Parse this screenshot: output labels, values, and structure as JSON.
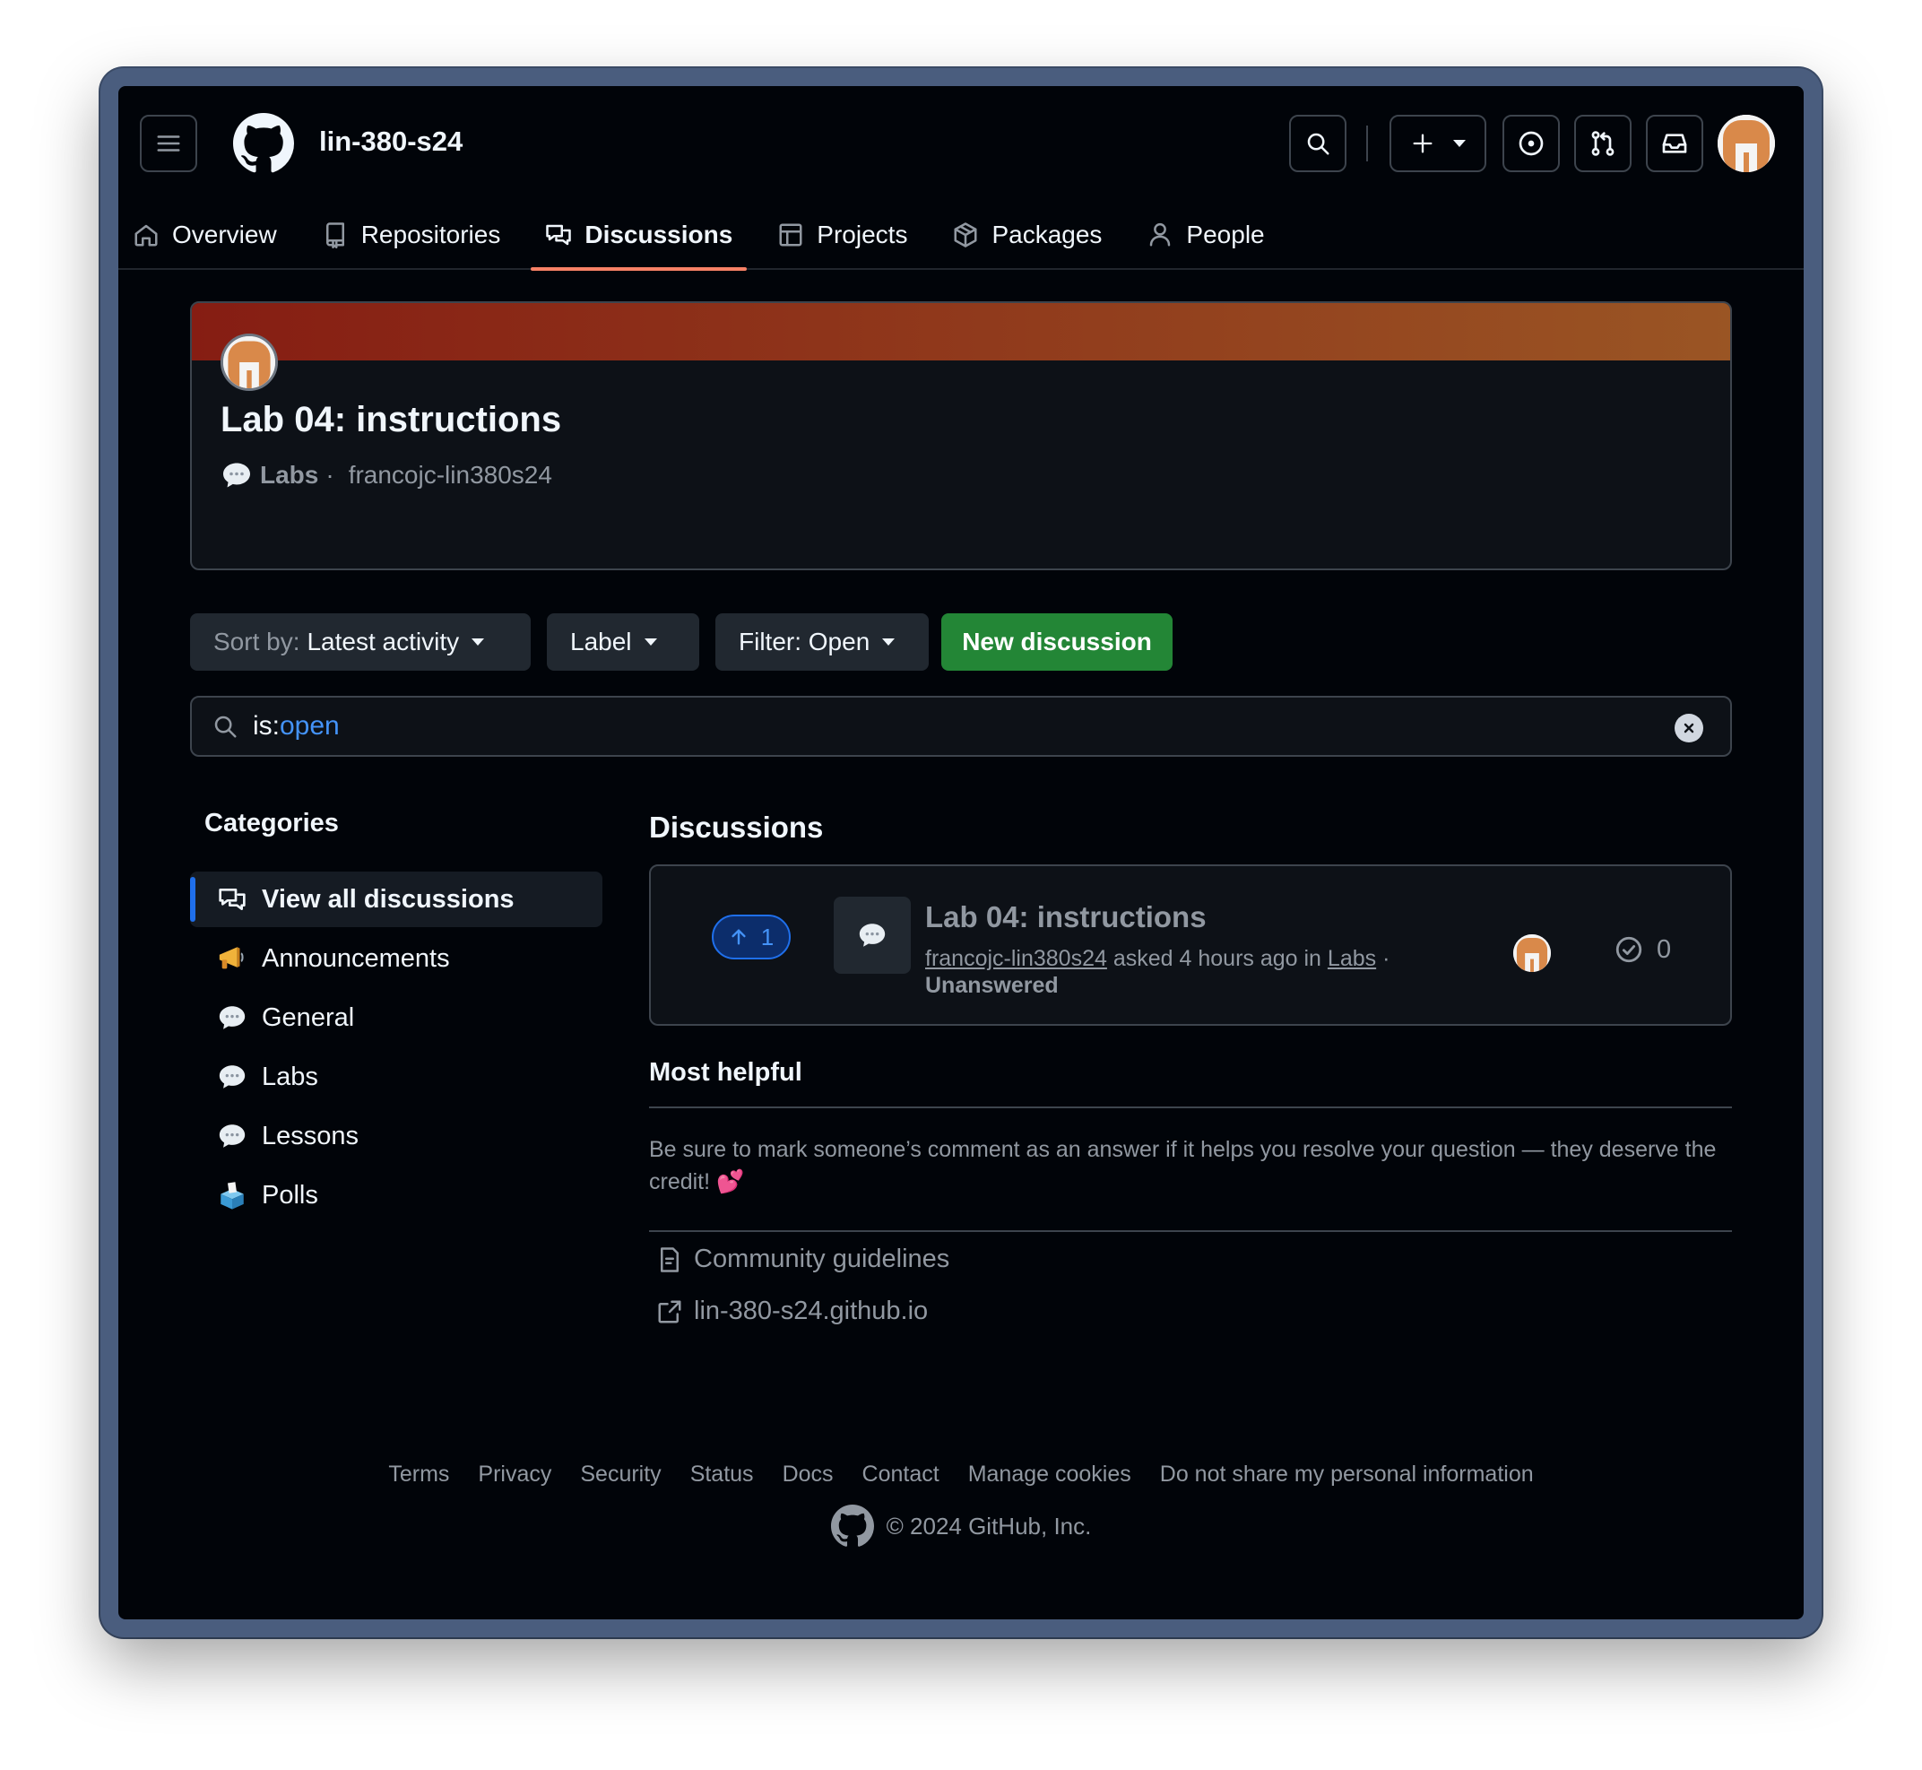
{
  "header": {
    "org_name": "lin-380-s24"
  },
  "nav": {
    "items": [
      {
        "label": "Overview",
        "icon": "home-icon"
      },
      {
        "label": "Repositories",
        "icon": "repo-icon"
      },
      {
        "label": "Discussions",
        "icon": "comment-discussion-icon",
        "active": true
      },
      {
        "label": "Projects",
        "icon": "table-icon"
      },
      {
        "label": "Packages",
        "icon": "package-icon"
      },
      {
        "label": "People",
        "icon": "person-icon"
      }
    ]
  },
  "banner": {
    "title": "Lab 04: instructions",
    "category": "Labs",
    "separator": "·",
    "author": "francojc-lin380s24"
  },
  "controls": {
    "sort_prefix": "Sort by:",
    "sort_value": "Latest activity",
    "label": "Label",
    "filter": "Filter: Open",
    "new_discussion": "New discussion"
  },
  "search": {
    "prefix": "is:",
    "value": "open"
  },
  "categories": {
    "heading": "Categories",
    "items": [
      {
        "label": "View all discussions",
        "icon": "comment-discussion-icon",
        "active": true
      },
      {
        "label": "Announcements",
        "icon": "megaphone-emoji"
      },
      {
        "label": "General",
        "icon": "speech-balloon-emoji"
      },
      {
        "label": "Labs",
        "icon": "speech-balloon-emoji"
      },
      {
        "label": "Lessons",
        "icon": "speech-balloon-emoji"
      },
      {
        "label": "Polls",
        "icon": "ballot-box-emoji"
      }
    ]
  },
  "discussions": {
    "heading": "Discussions",
    "items": [
      {
        "votes": "1",
        "title": "Lab 04: instructions",
        "author": "francojc-lin380s24",
        "asked": "asked 4 hours ago in",
        "category": "Labs",
        "separator": "·",
        "status": "Unanswered",
        "answers": "0"
      }
    ]
  },
  "most_helpful": {
    "heading": "Most helpful",
    "text": "Be sure to mark someone’s comment as an answer if it helps you resolve your question — they deserve the credit! 💕",
    "links": [
      {
        "label": "Community guidelines",
        "icon": "file-icon"
      },
      {
        "label": "lin-380-s24.github.io",
        "icon": "link-external-icon"
      }
    ]
  },
  "footer": {
    "links": [
      "Terms",
      "Privacy",
      "Security",
      "Status",
      "Docs",
      "Contact",
      "Manage cookies",
      "Do not share my personal information"
    ],
    "copyright": "© 2024 GitHub, Inc."
  },
  "colors": {
    "accent": "#f78166",
    "primary_button": "#238636",
    "link_blue": "#4493f8",
    "banner_gradient_start": "#861d13",
    "banner_gradient_end": "#9a5524"
  }
}
